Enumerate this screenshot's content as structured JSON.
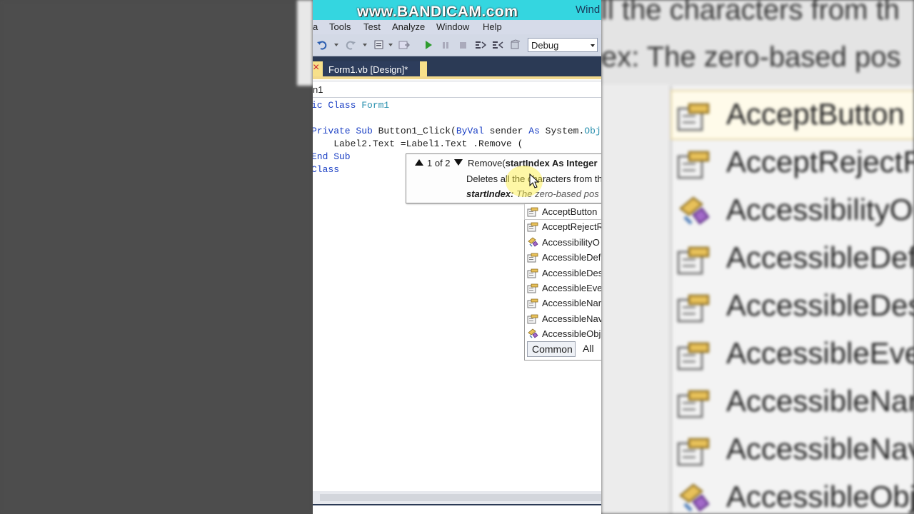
{
  "watermark": "www.BANDICAM.com",
  "window_title": "Wind",
  "menu": {
    "items": [
      {
        "label": "a"
      },
      {
        "label": "Tools"
      },
      {
        "label": "Test"
      },
      {
        "label": "Analyze"
      },
      {
        "label": "Window"
      },
      {
        "label": "Help"
      }
    ]
  },
  "toolbar": {
    "configuration": "Debug"
  },
  "tab": {
    "label": "Form1.vb [Design]*",
    "close_glyph": "×"
  },
  "navbar": {
    "class_name": "n1"
  },
  "code": {
    "line1": {
      "kw": "ic Class ",
      "type": "Form1"
    },
    "line2": {
      "kw1": "Private Sub ",
      "name": "Button1_Click(",
      "kw2": "ByVal ",
      "rest": "sender ",
      "kw3": "As ",
      "sys": "System.",
      "ty": "Obj"
    },
    "line3": "    Label2.Text =Label1.Text .Remove (",
    "line4": "End Sub",
    "line5": "Class"
  },
  "signature_tip": {
    "counter": "1 of 2",
    "method": "Remove(",
    "param_sig": "startIndex As Integer",
    "description": "Deletes all the characters from th",
    "param_name": "startIndex:",
    "param_desc": " The zero-based pos"
  },
  "completion": {
    "items": [
      {
        "label": "AcceptButton",
        "icon": "property-icon"
      },
      {
        "label": "AcceptRejectR",
        "icon": "property-icon"
      },
      {
        "label": "AccessibilityO",
        "icon": "event-icon"
      },
      {
        "label": "AccessibleDef",
        "icon": "property-icon"
      },
      {
        "label": "AccessibleDes",
        "icon": "property-icon"
      },
      {
        "label": "AccessibleEve",
        "icon": "property-icon"
      },
      {
        "label": "AccessibleNar",
        "icon": "property-icon"
      },
      {
        "label": "AccessibleNav",
        "icon": "property-icon"
      },
      {
        "label": "AccessibleObj",
        "icon": "event-icon"
      }
    ],
    "tab_common": "Common",
    "tab_all": "All"
  },
  "background_zoom": {
    "line1": "ll the characters from th",
    "param_name": "ex:",
    "param_desc": " The zero-based pos",
    "items": [
      "AcceptButton",
      "AcceptRejectR",
      "AccessibilityO",
      "AccessibleDef",
      "AccessibleDes",
      "AccessibleEve",
      "AccessibleNar",
      "AccessibleNav",
      "AccessibleObj"
    ]
  },
  "colors": {
    "title_bar": "#34d6e0",
    "dark_band": "#2b3a55",
    "tab_yellow": "#f7e08a",
    "keyword_blue": "#1a3fc4",
    "type_teal": "#2b91af"
  }
}
